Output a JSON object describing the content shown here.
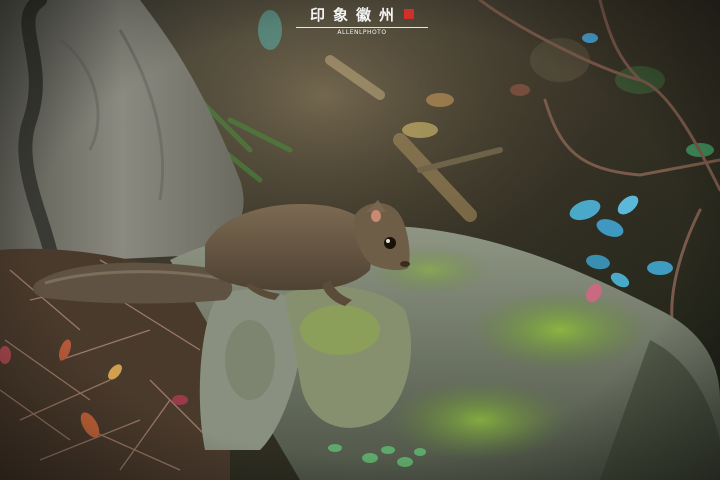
{
  "photo": {
    "subject": "squirrel",
    "colors": {
      "background_dark": "#1f2418",
      "rock_gray": "#7d8473",
      "moss_green": "#7fa83a",
      "squirrel_fur": "#6b5a45",
      "leaf_blue": "#4aa8c8",
      "dead_leaf_pink": "#c86a80"
    }
  },
  "watermark": {
    "title": "印象徽州",
    "subtitle": "ALLENLPHOTO"
  }
}
